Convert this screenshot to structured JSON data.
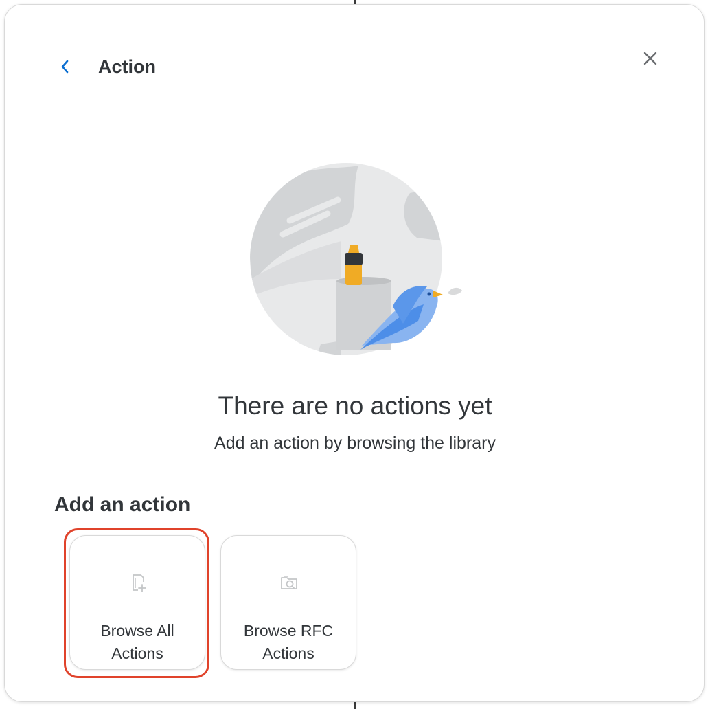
{
  "dialog": {
    "title": "Action",
    "back_icon": "chevron-left-icon",
    "close_icon": "close-icon",
    "accent_color": "#0a6ed1"
  },
  "empty_state": {
    "illustration": "bird-and-pen-cup-illustration",
    "title": "There are no actions yet",
    "subtitle": "Add an action by browsing the library"
  },
  "add_section": {
    "heading": "Add an action",
    "tiles": [
      {
        "icon": "add-document-icon",
        "label": "Browse All Actions",
        "highlighted": true
      },
      {
        "icon": "search-folder-icon",
        "label": "Browse RFC Actions",
        "highlighted": false
      }
    ],
    "highlight_color": "#e0432b"
  }
}
